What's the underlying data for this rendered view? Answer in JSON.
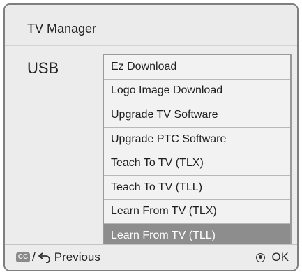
{
  "window": {
    "title": "TV Manager"
  },
  "section": {
    "label": "USB"
  },
  "menu": {
    "items": [
      {
        "label": "Ez Download"
      },
      {
        "label": "Logo Image Download"
      },
      {
        "label": "Upgrade TV Software"
      },
      {
        "label": "Upgrade PTC Software"
      },
      {
        "label": "Teach To TV (TLX)"
      },
      {
        "label": "Teach To TV (TLL)"
      },
      {
        "label": "Learn From TV (TLX)"
      },
      {
        "label": "Learn From TV (TLL)"
      }
    ],
    "selected_label": "Learn From TV (TLL)"
  },
  "footer": {
    "cc_icon_text": "CC",
    "separator": "/",
    "previous_label": "Previous",
    "ok_label": "OK",
    "icons": {
      "cc": "cc-icon",
      "back": "back-arrow-icon",
      "ok": "ok-button-icon"
    }
  },
  "colors": {
    "selected_bg": "#8d8d8d",
    "panel_bg": "#ececec",
    "border": "#7f7f7f"
  }
}
